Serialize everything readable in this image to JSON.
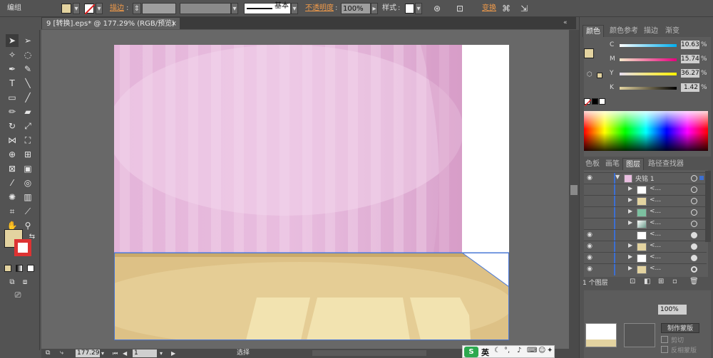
{
  "control_bar": {
    "group_label": "编组",
    "stroke_label": "描边",
    "stroke_style": "基本",
    "opacity_label": "不透明度",
    "opacity_value": "100%",
    "style_label": "样式",
    "transform_label": "变换",
    "fill_color": "#e3d3a0"
  },
  "document": {
    "tab_title": "9 [转换].eps* @ 177.29% (RGB/预览)",
    "close_icon": "×"
  },
  "status": {
    "zoom": "177.29",
    "page": "1",
    "mode": "选择"
  },
  "color_panel": {
    "tabs": [
      "颜色",
      "颜色参考",
      "描边",
      "渐变"
    ],
    "channels": [
      {
        "label": "C",
        "value": "10.63",
        "unit": "%"
      },
      {
        "label": "M",
        "value": "15.74",
        "unit": "%"
      },
      {
        "label": "Y",
        "value": "36.27",
        "unit": "%"
      },
      {
        "label": "K",
        "value": "1.42",
        "unit": "%"
      }
    ],
    "swatch": "#e3d3a0"
  },
  "layers_panel": {
    "tabs": [
      "色板",
      "画笔",
      "图层",
      "路径查找器"
    ],
    "top_layer": "央铭 1",
    "sublayer_placeholder": "<...",
    "footer": "1 个图层"
  },
  "transparency_panel": {
    "opacity": "100%",
    "make_mask": "制作蒙版",
    "clip": "剪切",
    "invert_mask": "反相蒙版"
  },
  "ime": {
    "label": "英"
  }
}
